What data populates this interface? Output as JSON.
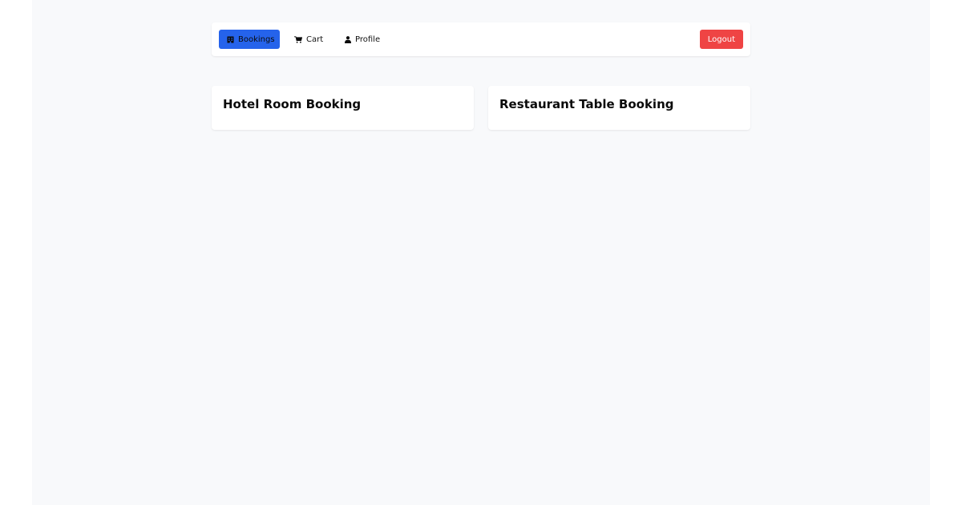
{
  "nav": {
    "items": [
      {
        "label": "Bookings",
        "icon": "building-icon",
        "active": true
      },
      {
        "label": "Cart",
        "icon": "cart-icon",
        "active": false
      },
      {
        "label": "Profile",
        "icon": "user-icon",
        "active": false
      }
    ],
    "logout_label": "Logout",
    "colors": {
      "active_bg": "#2563eb",
      "logout_bg": "#ef4444",
      "page_bg": "#f8f9fb"
    }
  },
  "cards": [
    {
      "title": "Hotel Room Booking"
    },
    {
      "title": "Restaurant Table Booking"
    }
  ]
}
